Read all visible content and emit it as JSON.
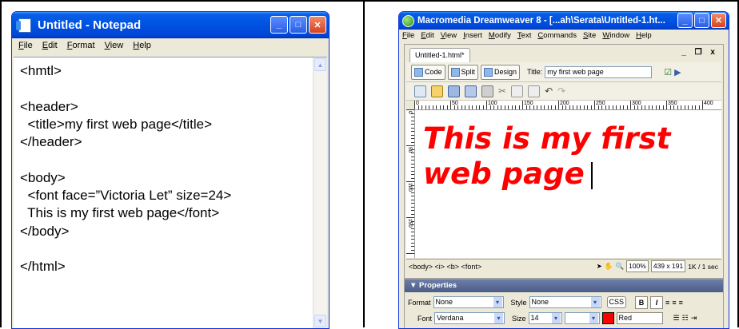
{
  "notepad": {
    "title": "Untitled - Notepad",
    "menu": [
      "File",
      "Edit",
      "Format",
      "View",
      "Help"
    ],
    "content": "<hmtl>\n\n<header>\n  <title>my first web page</title>\n</header>\n\n<body>\n  <font face=”Victoria Let” size=24>\n  This is my first web page</font>\n</body>\n\n</html>"
  },
  "dreamweaver": {
    "title": "Macromedia Dreamweaver 8 - [...ah\\Serata\\Untitled-1.ht...",
    "menu": [
      "File",
      "Edit",
      "View",
      "Insert",
      "Modify",
      "Text",
      "Commands",
      "Site",
      "Window",
      "Help"
    ],
    "doc_tab": "Untitled-1.html*",
    "doc_ctrls": "_ ❐ x",
    "view_buttons": {
      "code": "Code",
      "split": "Split",
      "design": "Design"
    },
    "title_label": "Title:",
    "page_title": "my first web page",
    "ruler_labels": [
      "0",
      "50",
      "100",
      "150",
      "200",
      "250",
      "300",
      "350",
      "400"
    ],
    "vruler_labels": [
      "0",
      "50",
      "100",
      "150"
    ],
    "canvas_text": "This is my first web page",
    "tag_path": "<body> <i> <b> <font>",
    "zoom": "100%",
    "window_size": "439 x 191",
    "download": "1K / 1 sec",
    "properties": {
      "header": "▼ Properties",
      "format_label": "Format",
      "format_value": "None",
      "style_label": "Style",
      "style_value": "None",
      "css_button": "CSS",
      "font_label": "Font",
      "font_value": "Verdana",
      "size_label": "Size",
      "size_value": "14",
      "color_value": "Red",
      "color": "#ff0000"
    }
  }
}
